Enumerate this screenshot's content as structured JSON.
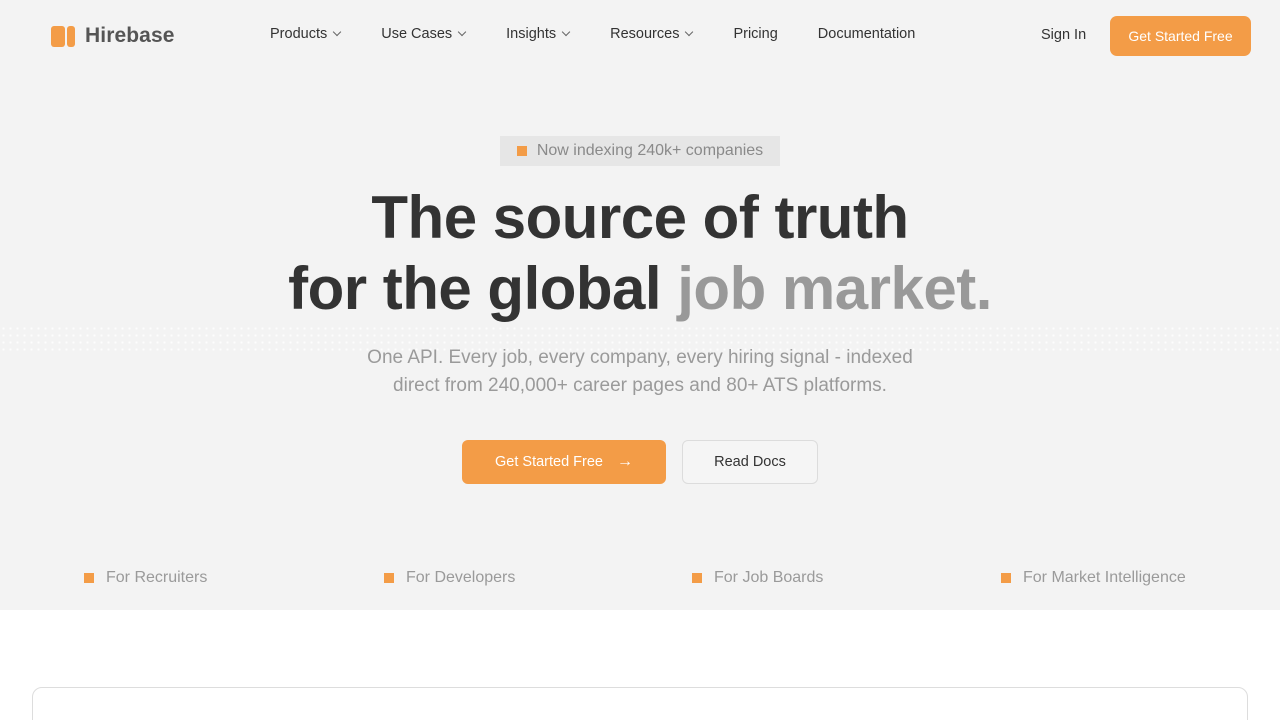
{
  "brand": {
    "name": "Hirebase",
    "accent": "#f39c47"
  },
  "nav": {
    "items": [
      {
        "label": "Products",
        "dropdown": true
      },
      {
        "label": "Use Cases",
        "dropdown": true
      },
      {
        "label": "Insights",
        "dropdown": true
      },
      {
        "label": "Resources",
        "dropdown": true
      },
      {
        "label": "Pricing",
        "dropdown": false
      },
      {
        "label": "Documentation",
        "dropdown": false
      }
    ],
    "sign_in": "Sign In",
    "cta": "Get Started Free"
  },
  "hero": {
    "badge": "Now indexing 240k+ companies",
    "title_line1": "The source of truth",
    "title_line2_main": "for the global",
    "title_line2_muted": "job market.",
    "subtitle_line1": "One API. Every job, every company, every hiring signal - indexed",
    "subtitle_line2": "direct from 240,000+ career pages and 80+ ATS platforms.",
    "primary_cta": "Get Started Free",
    "secondary_cta": "Read Docs"
  },
  "audiences": [
    "For Recruiters",
    "For Developers",
    "For Job Boards",
    "For Market Intelligence"
  ]
}
